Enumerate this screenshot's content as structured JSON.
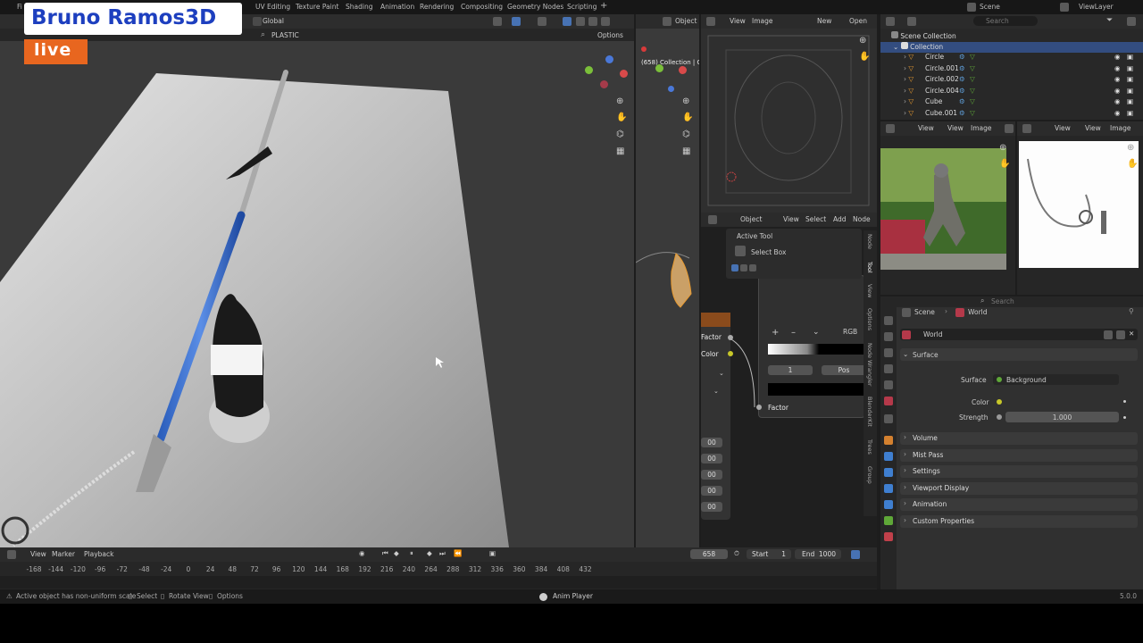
{
  "logo": {
    "name": "Bruno Ramos3D",
    "badge": "live"
  },
  "topbar": {
    "menu_partial": "Fi",
    "workspace_tabs": [
      "UV Editing",
      "Texture Paint",
      "Shading",
      "Animation",
      "Rendering",
      "Compositing",
      "Geometry Nodes",
      "Scripting"
    ],
    "add_tab": "+",
    "scene_label": "Scene",
    "viewlayer_label": "ViewLayer"
  },
  "viewport3d": {
    "orientation": "Global",
    "material_filter": "PLASTIC",
    "options_label": "Options"
  },
  "viewport2": {
    "object_mode": "Object",
    "info_line1": "(658) Collection | C"
  },
  "image_editor_top": {
    "view": "View",
    "image": "Image",
    "new": "New",
    "open": "Open"
  },
  "node_editor": {
    "mode": "Object",
    "menu": [
      "View",
      "Select",
      "Add",
      "Node"
    ],
    "active_tool_title": "Active Tool",
    "select_box": "Select Box",
    "side_tabs": [
      "Node",
      "Tool",
      "View",
      "Options",
      "Node Wrangler",
      "BlenderKit",
      "Trees",
      "Group"
    ],
    "socket_factor": "Factor",
    "socket_color": "Color",
    "ramp_plus": "+",
    "ramp_minus": "–",
    "ramp_mode": "RGB",
    "ramp_index": "1",
    "ramp_pos": "Pos",
    "output_factor": "Factor",
    "left_values": [
      "00",
      "00",
      "00",
      "00",
      "00"
    ]
  },
  "outliner": {
    "search_placeholder": "Search",
    "scene_collection": "Scene Collection",
    "collection": "Collection",
    "items": [
      "Circle",
      "Circle.001",
      "Circle.002",
      "Circle.004",
      "Cube",
      "Cube.001"
    ]
  },
  "image_viewers": {
    "left_view": "View",
    "left_view2": "View",
    "left_image": "Image",
    "right_view": "View",
    "right_view2": "View",
    "right_image": "Image"
  },
  "properties": {
    "search_placeholder": "Search",
    "breadcrumb_scene": "Scene",
    "breadcrumb_world": "World",
    "datablock": "World",
    "surface_panel": "Surface",
    "surface_label": "Surface",
    "surface_value": "Background",
    "color_label": "Color",
    "strength_label": "Strength",
    "strength_value": "1.000",
    "panels": [
      "Volume",
      "Mist Pass",
      "Settings",
      "Viewport Display",
      "Animation",
      "Custom Properties"
    ]
  },
  "timeline": {
    "menu": [
      "View",
      "Marker",
      "Playback"
    ],
    "frame": "658",
    "start_label": "Start",
    "start_value": "1",
    "end_label": "End",
    "end_value": "1000",
    "ticks": [
      "-168",
      "-144",
      "-120",
      "-96",
      "-72",
      "-48",
      "-24",
      "0",
      "24",
      "48",
      "72",
      "96",
      "120",
      "144",
      "168",
      "192",
      "216",
      "240",
      "264",
      "288",
      "312",
      "336",
      "360",
      "384",
      "408",
      "432"
    ]
  },
  "statusbar": {
    "message": "Active object has non-uniform scale",
    "select": "Select",
    "rotate": "Rotate View",
    "options": "Options",
    "anim_player": "Anim Player",
    "version": "5.0.0"
  },
  "colors": {
    "accent": "#4772b3",
    "live": "#e8661f",
    "logo_text": "#1d3fbf",
    "selected_row": "#334d80",
    "header": "#2b2b2b",
    "panel_bg": "#303030"
  }
}
